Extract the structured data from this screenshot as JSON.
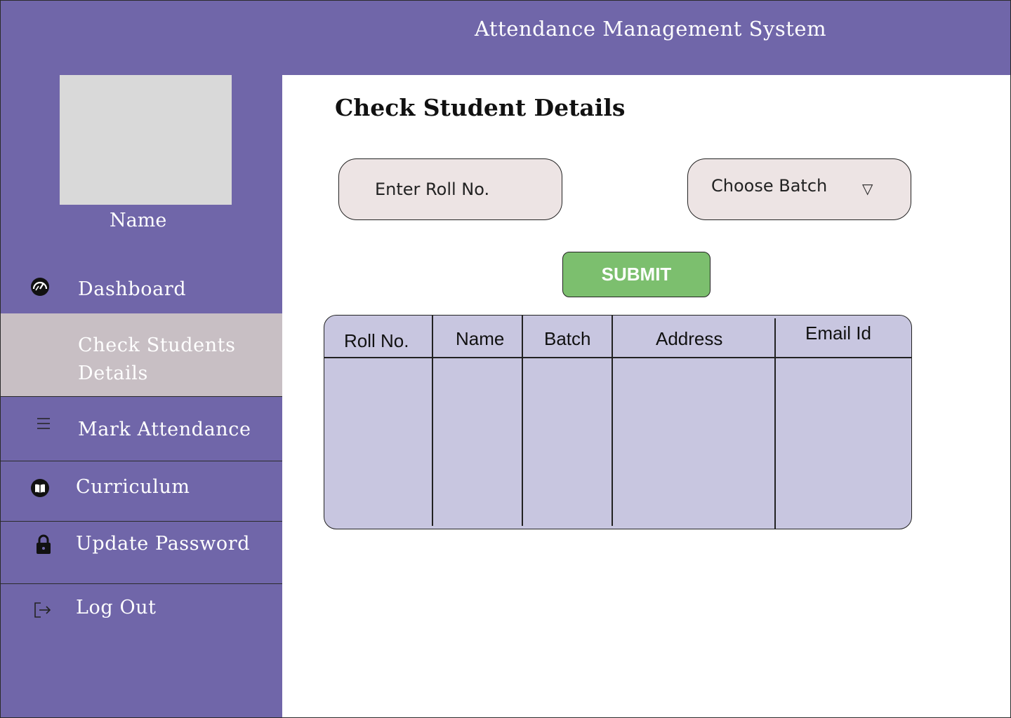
{
  "app": {
    "title": "Attendance Management System"
  },
  "user": {
    "name": "Name"
  },
  "sidebar": {
    "items": [
      {
        "label": "Dashboard",
        "icon": "dashboard-icon",
        "active": false
      },
      {
        "label": "Check Students Details",
        "icon": "",
        "active": true
      },
      {
        "label": "Mark Attendance",
        "icon": "menu-icon",
        "active": false
      },
      {
        "label": "Curriculum",
        "icon": "book-icon",
        "active": false
      },
      {
        "label": "Update Password",
        "icon": "lock-icon",
        "active": false
      },
      {
        "label": "Log Out",
        "icon": "logout-icon",
        "active": false
      }
    ]
  },
  "main": {
    "title": "Check Student Details",
    "roll_input": {
      "placeholder": "Enter Roll No.",
      "value": ""
    },
    "batch_select": {
      "value": "Choose Batch"
    },
    "submit_label": "SUBMIT",
    "table": {
      "columns": [
        "Roll No.",
        "Name",
        "Batch",
        "Address",
        "Email Id"
      ],
      "rows": []
    }
  },
  "colors": {
    "sidebar_bg": "#7066a9",
    "active_item_bg": "#c8bfc4",
    "submit_bg": "#7cbf6e",
    "table_bg": "#c8c6e0",
    "input_bg": "#ede4e4"
  }
}
